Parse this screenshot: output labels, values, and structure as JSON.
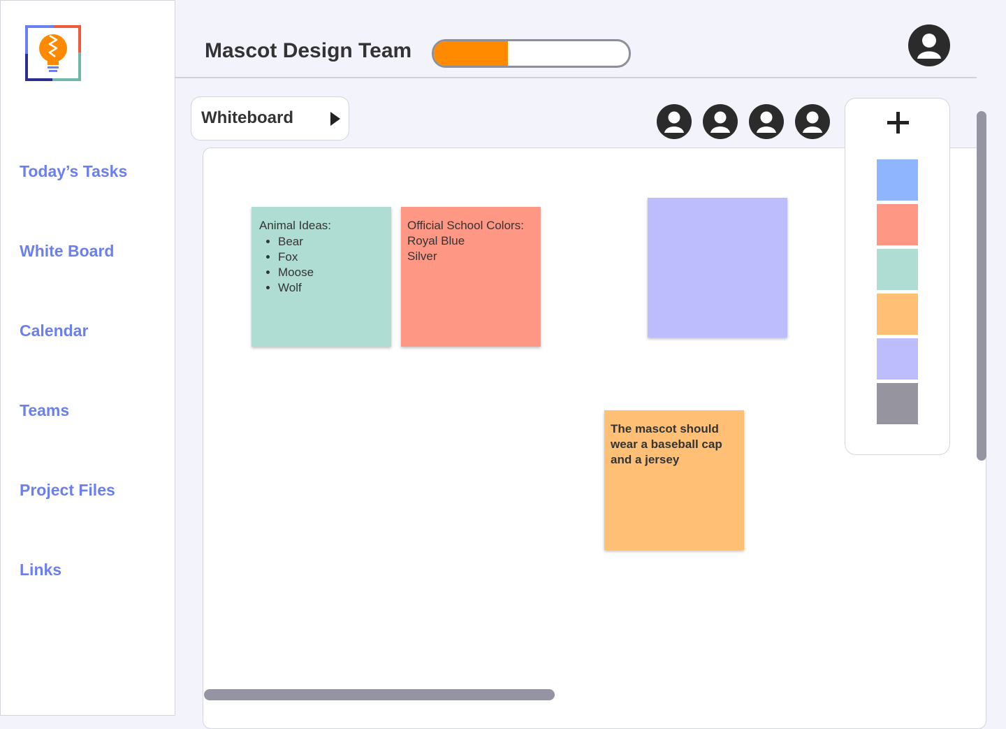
{
  "sidebar": {
    "logo_icon": "lightbulb-icon",
    "items": [
      {
        "label": "Today’s Tasks"
      },
      {
        "label": "White Board"
      },
      {
        "label": "Calendar"
      },
      {
        "label": "Teams"
      },
      {
        "label": "Project Files"
      },
      {
        "label": "Links"
      }
    ]
  },
  "header": {
    "title": "Mascot Design Team",
    "progress_percent": 38,
    "user_icon": "user-avatar-icon"
  },
  "board_selector": {
    "label": "Whiteboard",
    "icon": "play-arrow-icon"
  },
  "collaborators": [
    "user-avatar-icon",
    "user-avatar-icon",
    "user-avatar-icon",
    "user-avatar-icon"
  ],
  "notes": [
    {
      "color": "#afddd3",
      "title": "Animal Ideas:",
      "items": [
        "Bear",
        "Fox",
        "Moose",
        "Wolf"
      ]
    },
    {
      "color": "#fe9784",
      "lines": [
        "Official School Colors:",
        "Royal Blue",
        "Silver"
      ]
    },
    {
      "color": "#bdbdfe"
    },
    {
      "color": "#ffc076",
      "lines": [
        "The mascot should",
        "wear a baseball cap",
        "and a jersey"
      ]
    }
  ],
  "palette": {
    "add_icon": "plus-icon",
    "colors": [
      "#8fb5fe",
      "#fe9784",
      "#afddd3",
      "#ffc076",
      "#bdbdfe",
      "#95949f"
    ]
  },
  "colors": {
    "accent": "#6b7ff0",
    "progress": "#ff8a00"
  }
}
